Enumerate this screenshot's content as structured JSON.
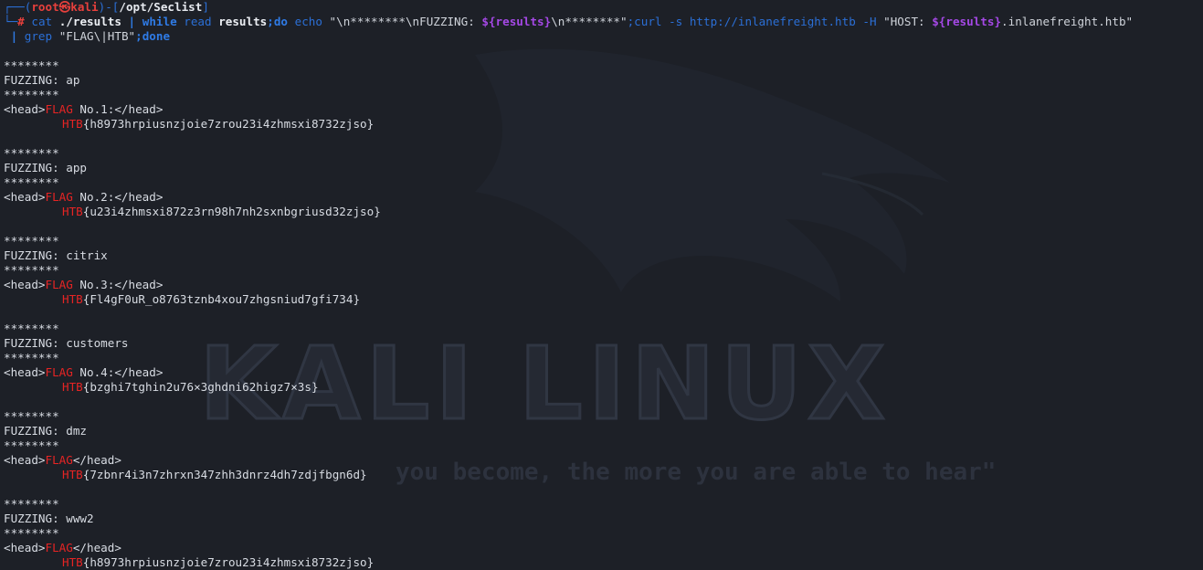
{
  "prompt": {
    "frame_top": "┌──(",
    "user": "root㉿kali",
    "frame_mid": ")-[",
    "cwd": "/opt/Seclist",
    "frame_end": "]",
    "frame_bottom": "└─",
    "hash": "#"
  },
  "command": {
    "cat": "cat",
    "file": "./results",
    "pipe1": "|",
    "while": "while",
    "read": "read",
    "var_name": "results",
    "do": ";do",
    "echo": "echo",
    "echo_str_1": "\"\\n********\\nFUZZING: ",
    "echo_var": "${results}",
    "echo_str_2": "\\n********\"",
    "curl": ";curl -s http://inlanefreight.htb -H ",
    "header_str_1": "\"HOST: ",
    "header_var": "${results}",
    "header_str_2": ".inlanefreight.htb\"",
    "line2_pipe": " |",
    "grep": "grep",
    "grep_pattern": "\"FLAG\\|HTB\"",
    "done": ";done"
  },
  "separator": "********",
  "fuzz_label": "FUZZING: ",
  "flag_word": "FLAG",
  "htb_word": "HTB",
  "results": [
    {
      "name": "ap",
      "head_pre": "<head>",
      "head_post": " No.1:</head>",
      "flag_value": "{h8973hrpiusnzjoie7zrou23i4zhmsxi8732zjso}"
    },
    {
      "name": "app",
      "head_pre": "<head>",
      "head_post": " No.2:</head>",
      "flag_value": "{u23i4zhmsxi872z3rn98h7nh2sxnbgriusd32zjso}"
    },
    {
      "name": "citrix",
      "head_pre": "<head>",
      "head_post": " No.3:</head>",
      "flag_value": "{Fl4gF0uR_o8763tznb4xou7zhgsniud7gfi734}"
    },
    {
      "name": "customers",
      "head_pre": "<head>",
      "head_post": " No.4:</head>",
      "flag_value": "{bzghi7tghin2u76×3ghdni62higz7×3s}"
    },
    {
      "name": "dmz",
      "head_pre": "<head>",
      "head_post": "</head>",
      "flag_value": "{7zbnr4i3n7zhrxn347zhh3dnrz4dh7zdjfbgn6d}"
    },
    {
      "name": "www2",
      "head_pre": "<head>",
      "head_post": "</head>",
      "flag_value": "{h8973hrpiusnzjoie7zrou23i4zhmsxi8732zjso}"
    }
  ],
  "wallpaper": {
    "logo_text": "KALI LINUX",
    "quote_text": "you become, the more you are able to hear\""
  },
  "colors": {
    "background": "#1d2027",
    "prompt_blue": "#2b6fd6",
    "prompt_red": "#e8403c",
    "flag_red": "#e62424",
    "variable_purple": "#a548e6",
    "text": "#d8dce3"
  }
}
